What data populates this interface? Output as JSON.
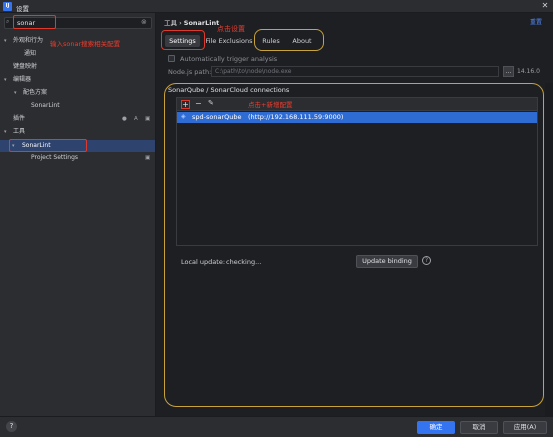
{
  "window": {
    "logo": "IJ",
    "title": "设置",
    "close_glyph": "✕"
  },
  "sidebar": {
    "search": {
      "value": "sonar",
      "placeholder": ""
    },
    "annotation": "输入sonar搜索相关配置",
    "items": [
      {
        "label": "外观和行为",
        "arrow": "▾",
        "level": 0
      },
      {
        "label": "通知",
        "arrow": "",
        "level": 2
      },
      {
        "label": "键盘映射",
        "arrow": "",
        "level": 0
      },
      {
        "label": "编辑器",
        "arrow": "▾",
        "level": 0
      },
      {
        "label": "配色方案",
        "arrow": "▾",
        "level": 1
      },
      {
        "label": "SonarLint",
        "arrow": "",
        "level": 3
      },
      {
        "label": "插件",
        "arrow": "",
        "level": 0
      },
      {
        "label": "工具",
        "arrow": "▾",
        "level": 0
      },
      {
        "label": "SonarLint",
        "arrow": "▾",
        "level": 1
      },
      {
        "label": "Project Settings",
        "arrow": "",
        "level": 3
      }
    ]
  },
  "main": {
    "breadcrumb": {
      "parent": "工具",
      "separator": "›",
      "current": "SonarLint"
    },
    "reset": "重置",
    "settings_annotation": "点击设置",
    "tabs": [
      {
        "label": "Settings"
      },
      {
        "label": "File Exclusions"
      },
      {
        "label": "Rules"
      },
      {
        "label": "About"
      }
    ],
    "auto_trigger_label": "Automatically trigger analysis",
    "node_label": "Node.js path:",
    "node_path_placeholder": "C:\\path\\to\\node\\node.exe",
    "node_browse": "...",
    "node_version": "14.16.0",
    "connections": {
      "title": "SonarQube / SonarCloud connections",
      "add_annotation": "点击+新增配置",
      "rows": [
        {
          "name": "spd-sonarQube",
          "url": "(http://192.168.111.59:9000)"
        }
      ]
    },
    "local_update_label": "Local update:",
    "local_update_status": "checking...",
    "update_binding_label": "Update binding"
  },
  "footer": {
    "help": "?",
    "ok": "确定",
    "cancel": "取消",
    "apply": "应用(A)"
  }
}
